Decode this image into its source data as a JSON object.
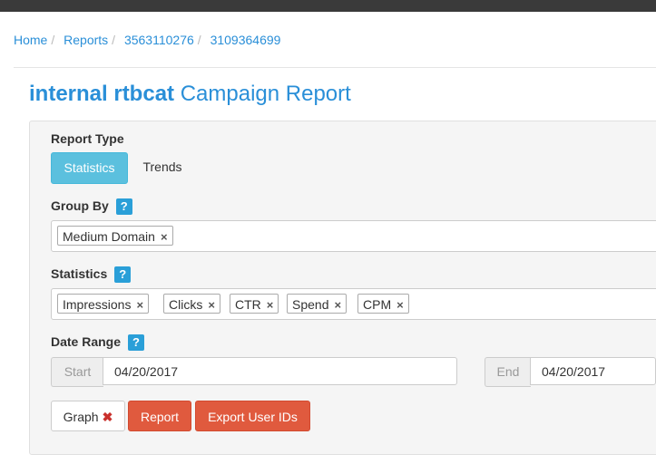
{
  "breadcrumb": [
    "Home",
    "Reports",
    "3563110276",
    "3109364699"
  ],
  "title": {
    "bold": "internal rtbcat",
    "rest": "Campaign Report"
  },
  "report_type": {
    "label": "Report Type",
    "options": [
      "Statistics",
      "Trends"
    ],
    "selected": "Statistics"
  },
  "group_by": {
    "label": "Group By",
    "help": "?",
    "tags": [
      "Medium Domain"
    ]
  },
  "statistics": {
    "label": "Statistics",
    "help": "?",
    "tags": [
      "Impressions",
      "Clicks",
      "CTR",
      "Spend",
      "CPM"
    ]
  },
  "date_range": {
    "label": "Date Range",
    "help": "?",
    "start_label": "Start",
    "start_value": "04/20/2017",
    "end_label": "End",
    "end_value": "04/20/2017"
  },
  "actions": {
    "graph": "Graph",
    "report": "Report",
    "export": "Export User IDs"
  },
  "icons": {
    "remove_tag": "×",
    "graph_remove": "✖"
  },
  "colors": {
    "accent": "#2a8fd8",
    "primary_info": "#5bc0de",
    "danger": "#e05a3e"
  }
}
